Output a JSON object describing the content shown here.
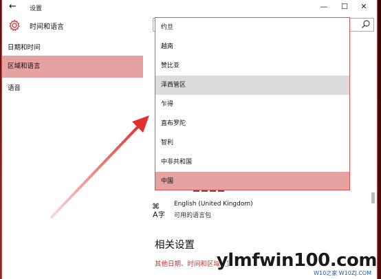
{
  "window": {
    "title": "设置",
    "back_glyph": "←",
    "minimize_glyph": "—",
    "maximize_glyph": "☐",
    "close_glyph": "✕"
  },
  "header": {
    "title": "时间和语言"
  },
  "sidebar": {
    "items": [
      {
        "label": "日期和时间",
        "active": false
      },
      {
        "label": "区域和语言",
        "active": true
      },
      {
        "label": "语音",
        "active": false
      }
    ]
  },
  "dropdown": {
    "items": [
      {
        "label": "约旦",
        "state": "normal"
      },
      {
        "label": "越南",
        "state": "normal"
      },
      {
        "label": "赞比亚",
        "state": "normal"
      },
      {
        "label": "泽西管区",
        "state": "hover"
      },
      {
        "label": "乍得",
        "state": "normal"
      },
      {
        "label": "直布罗陀",
        "state": "normal"
      },
      {
        "label": "智利",
        "state": "normal"
      },
      {
        "label": "中非共和国",
        "state": "normal"
      },
      {
        "label": "中国",
        "state": "selected"
      }
    ]
  },
  "language": {
    "name": "English (United Kingdom)",
    "status": "可用的语言包",
    "icon": "language-icon"
  },
  "related": {
    "title": "相关设置",
    "link": "其他日期、时间和区域设置"
  },
  "watermark": {
    "text": "ylmfwin100.com",
    "sub": "W10之家 W10ZJ.COM"
  },
  "colors": {
    "accent": "#e6a1a1",
    "hover": "#dcdcdc",
    "link": "#d03030",
    "annotation_arrow": "#e03c3c"
  }
}
